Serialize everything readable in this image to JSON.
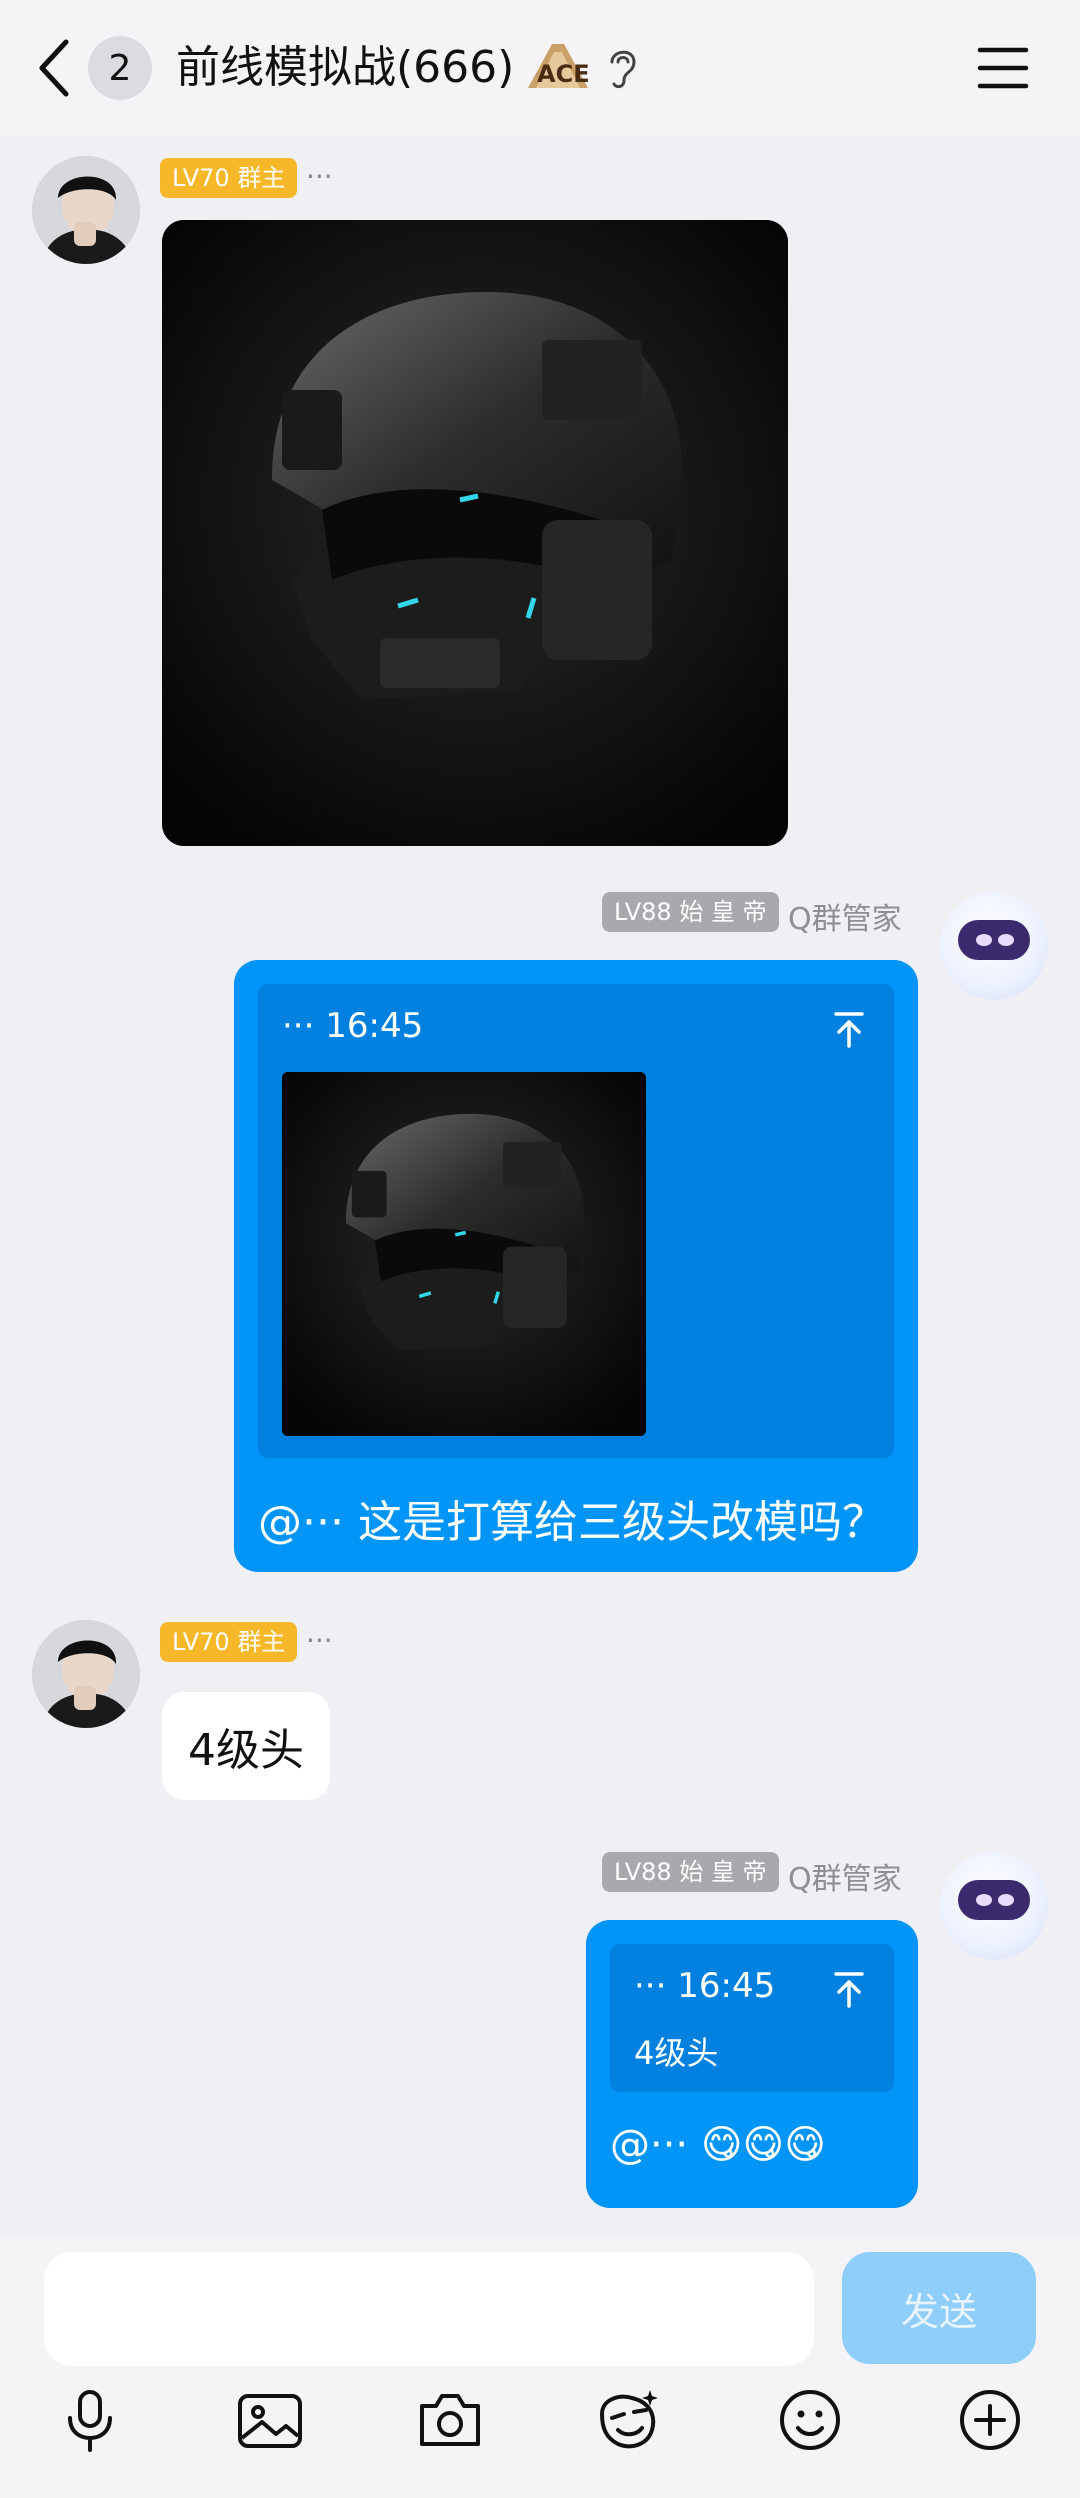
{
  "header": {
    "back_icon": "chevron-left-icon",
    "unread_count": "2",
    "title": "前线模拟战(666)",
    "title_icon": "ace-badge-icon",
    "ear_icon": "ear-icon",
    "menu_icon": "menu-icon"
  },
  "messages": [
    {
      "sender_level": "LV70 群主",
      "sender_name": "···",
      "type": "image",
      "image_desc": "black tactical helmet"
    },
    {
      "sender_level": "LV88 始 皇 帝",
      "sender_name": "Q群管家",
      "quote_meta": "··· 16:45",
      "text": "@··· 这是打算给三级头改模吗？"
    },
    {
      "sender_level": "LV70 群主",
      "sender_name": "···",
      "text": "4级头"
    },
    {
      "sender_level": "LV88 始 皇 帝",
      "sender_name": "Q群管家",
      "quote_meta": "··· 16:45",
      "quote_text": "4级头",
      "text": "@··· 😋😋😋"
    }
  ],
  "input": {
    "placeholder": "",
    "send_label": "发送"
  },
  "toolbar": [
    "microphone-icon",
    "image-icon",
    "camera-icon",
    "sticker-face-icon",
    "emoji-icon",
    "plus-icon"
  ],
  "colors": {
    "bubble_blue": "#0095f7",
    "quote_blue": "#0081e0",
    "level_yellow": "#f6b728",
    "level_gray": "#a9a9ad",
    "send_disabled": "#8fcdfa"
  }
}
